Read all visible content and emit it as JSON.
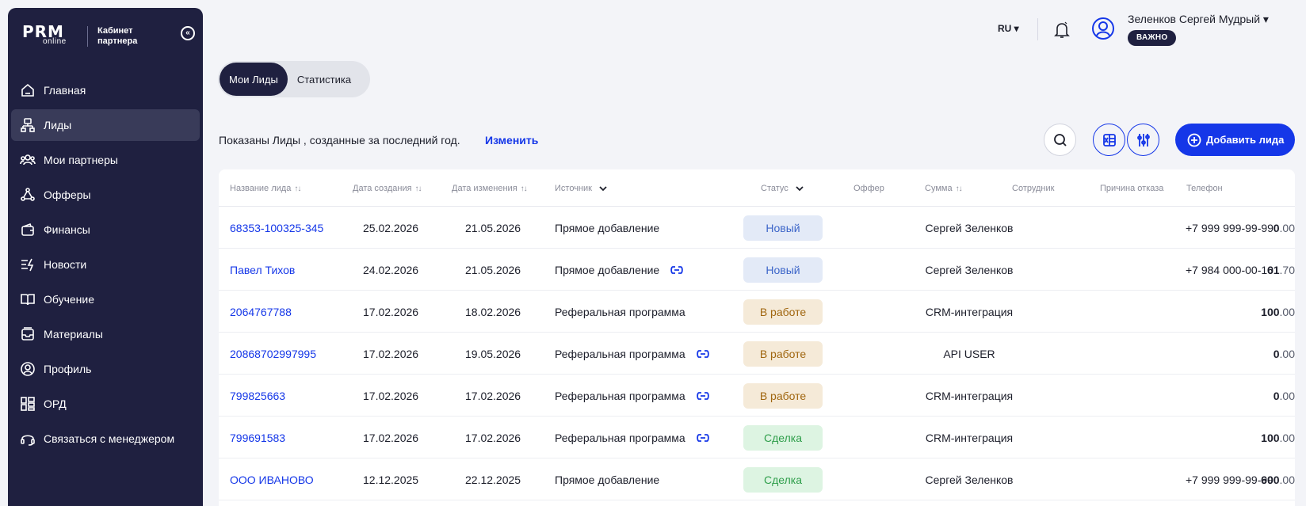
{
  "brand": {
    "logo_main": "PRM",
    "logo_sub": "online",
    "cabinet_text": "Кабинет партнера"
  },
  "sidebar": {
    "items": [
      {
        "label": "Главная",
        "icon": "home-icon"
      },
      {
        "label": "Лиды",
        "icon": "leads-icon",
        "active": true
      },
      {
        "label": "Мои партнеры",
        "icon": "partners-icon"
      },
      {
        "label": "Офферы",
        "icon": "offers-icon"
      },
      {
        "label": "Финансы",
        "icon": "wallet-icon"
      },
      {
        "label": "Новости",
        "icon": "news-icon"
      },
      {
        "label": "Обучение",
        "icon": "book-icon"
      },
      {
        "label": "Материалы",
        "icon": "materials-icon"
      },
      {
        "label": "Профиль",
        "icon": "profile-icon"
      },
      {
        "label": "ОРД",
        "icon": "ord-icon"
      },
      {
        "label": "Связаться с менеджером",
        "icon": "headset-icon"
      }
    ]
  },
  "header": {
    "language": "RU ▾",
    "user_name": "Зеленков Сергей Мудрый ▾",
    "badge": "ВАЖНО"
  },
  "tabs": [
    {
      "label": "Мои Лиды",
      "active": true
    },
    {
      "label": "Статистика"
    }
  ],
  "filter": {
    "text": "Показаны Лиды , созданные за последний год.",
    "change_link": "Изменить"
  },
  "add_button": "Добавить лида",
  "table": {
    "columns": {
      "name": "Название лида",
      "created": "Дата создания",
      "updated": "Дата изменения",
      "source": "Источник",
      "status": "Статус",
      "offer": "Оффер",
      "sum": "Сумма",
      "employee": "Сотрудник",
      "reason": "Причина отказа",
      "phone": "Телефон"
    },
    "sort_glyph": "↑↓",
    "rows": [
      {
        "name": "68353-100325-345",
        "created": "25.02.2026",
        "updated": "21.05.2026",
        "source": "Прямое добавление",
        "link": false,
        "status": "Новый",
        "status_type": "new",
        "sum_int": "0",
        "sum_dec": ".00",
        "employee": "Сергей Зеленков",
        "phone": "+7 999 999-99-99"
      },
      {
        "name": "Павел Тихов",
        "created": "24.02.2026",
        "updated": "21.05.2026",
        "source": "Прямое добавление",
        "link": true,
        "status": "Новый",
        "status_type": "new",
        "sum_int": "61",
        "sum_dec": ".70",
        "employee": "Сергей Зеленков",
        "phone": "+7 984 000-00-10"
      },
      {
        "name": "2064767788",
        "created": "17.02.2026",
        "updated": "18.02.2026",
        "source": "Реферальная программа",
        "link": false,
        "status": "В работе",
        "status_type": "work",
        "sum_int": "100",
        "sum_dec": ".00",
        "employee": "CRM-интеграция",
        "phone": ""
      },
      {
        "name": "20868702997995",
        "created": "17.02.2026",
        "updated": "19.05.2026",
        "source": "Реферальная программа",
        "link": true,
        "status": "В работе",
        "status_type": "work",
        "sum_int": "0",
        "sum_dec": ".00",
        "employee": "API USER",
        "phone": ""
      },
      {
        "name": "799825663",
        "created": "17.02.2026",
        "updated": "17.02.2026",
        "source": "Реферальная программа",
        "link": true,
        "status": "В работе",
        "status_type": "work",
        "sum_int": "0",
        "sum_dec": ".00",
        "employee": "CRM-интеграция",
        "phone": ""
      },
      {
        "name": "799691583",
        "created": "17.02.2026",
        "updated": "17.02.2026",
        "source": "Реферальная программа",
        "link": true,
        "status": "Сделка",
        "status_type": "deal",
        "sum_int": "100",
        "sum_dec": ".00",
        "employee": "CRM-интеграция",
        "phone": ""
      },
      {
        "name": "ООО ИВАНОВО",
        "created": "12.12.2025",
        "updated": "22.12.2025",
        "source": "Прямое добавление",
        "link": false,
        "status": "Сделка",
        "status_type": "deal",
        "sum_int": "600",
        "sum_dec": ".00",
        "employee": "Сергей Зеленков",
        "phone": "+7 999 999-99-99"
      }
    ]
  },
  "colors": {
    "sidebar_bg": "#1f2040",
    "accent": "#1537e8",
    "status_new": "#3d66c9",
    "status_work": "#a0660f",
    "status_deal": "#2f9e4b"
  }
}
